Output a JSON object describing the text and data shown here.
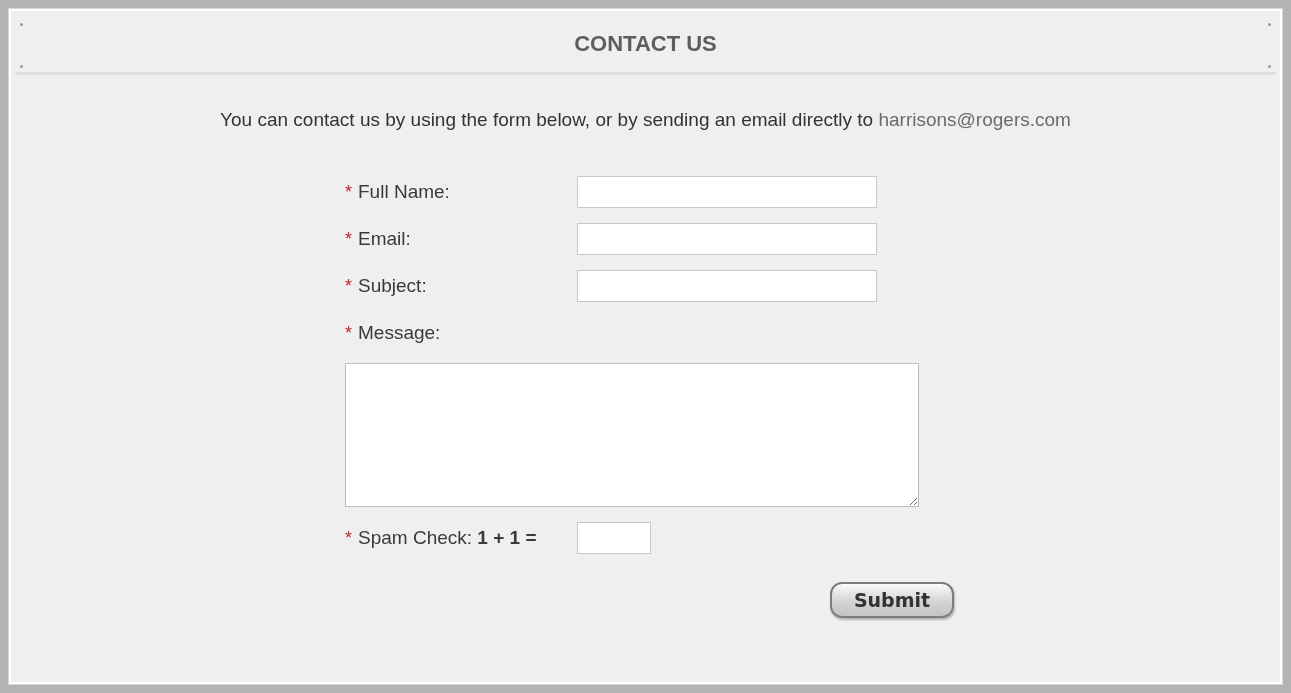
{
  "title": "CONTACT US",
  "intro": {
    "text": "You can contact us by using the form below, or by sending an email directly to",
    "email": "harrisons@rogers.com"
  },
  "fields": [
    {
      "kind": "text",
      "mark": "*",
      "label": "Full Name:"
    },
    {
      "kind": "text",
      "mark": "*",
      "label": "Email:"
    },
    {
      "kind": "text",
      "mark": "*",
      "label": "Subject:"
    },
    {
      "kind": "textarea",
      "mark": "*",
      "label": "Message:"
    },
    {
      "kind": "captcha",
      "mark": "*",
      "label": "Spam Check: **1 + 1 =**"
    }
  ],
  "submit": "Submit"
}
